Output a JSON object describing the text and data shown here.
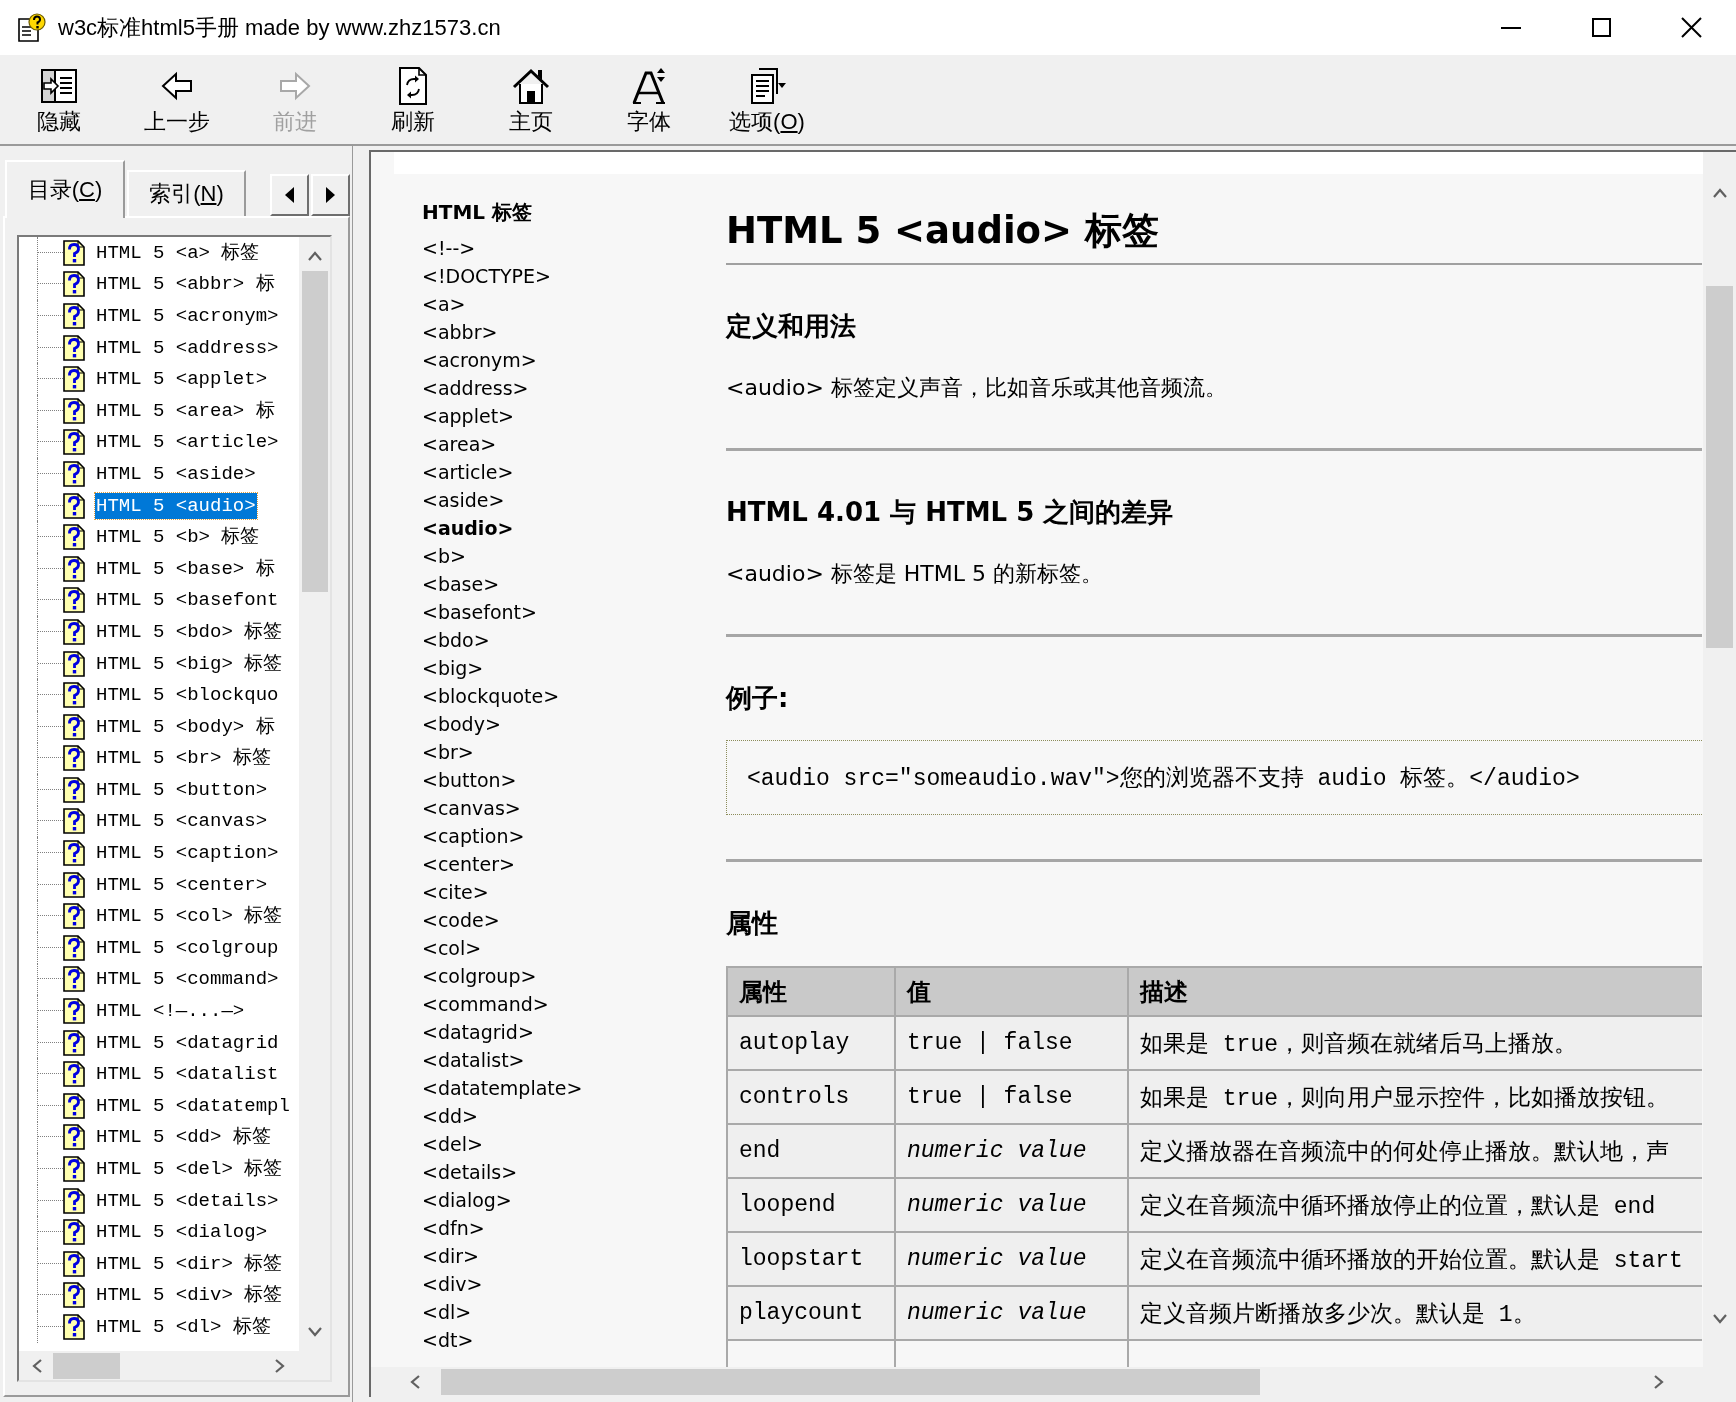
{
  "window": {
    "title": "w3c标准html5手册 made by www.zhz1573.cn"
  },
  "toolbar": [
    {
      "kind": "hide",
      "label": "隐藏",
      "disabled": false
    },
    {
      "kind": "back",
      "label": "上一步",
      "disabled": false
    },
    {
      "kind": "forward",
      "label": "前进",
      "disabled": true
    },
    {
      "kind": "refresh",
      "label": "刷新",
      "disabled": false
    },
    {
      "kind": "home",
      "label": "主页",
      "disabled": false
    },
    {
      "kind": "font",
      "label": "字体",
      "disabled": false
    },
    {
      "kind": "options",
      "label": "选项(O)",
      "disabled": false
    }
  ],
  "navigation_pane": {
    "tabs": [
      {
        "label": "目录(C)",
        "selected": true
      },
      {
        "label": "索引(N)",
        "selected": false
      }
    ],
    "tree": [
      {
        "label": "HTML 5 <a> 标签",
        "selected": false
      },
      {
        "label": "HTML 5 <abbr> 标",
        "selected": false
      },
      {
        "label": "HTML 5 <acronym>",
        "selected": false
      },
      {
        "label": "HTML 5 <address>",
        "selected": false
      },
      {
        "label": "HTML 5 <applet>",
        "selected": false
      },
      {
        "label": "HTML 5 <area> 标",
        "selected": false
      },
      {
        "label": "HTML 5 <article>",
        "selected": false
      },
      {
        "label": "HTML 5 <aside>",
        "selected": false
      },
      {
        "label": "HTML 5 <audio>",
        "selected": true
      },
      {
        "label": "HTML 5 <b> 标签",
        "selected": false
      },
      {
        "label": "HTML 5 <base> 标",
        "selected": false
      },
      {
        "label": "HTML 5 <basefont",
        "selected": false
      },
      {
        "label": "HTML 5 <bdo> 标签",
        "selected": false
      },
      {
        "label": "HTML 5 <big> 标签",
        "selected": false
      },
      {
        "label": "HTML 5 <blockquo",
        "selected": false
      },
      {
        "label": "HTML 5 <body> 标",
        "selected": false
      },
      {
        "label": "HTML 5 <br> 标签",
        "selected": false
      },
      {
        "label": "HTML 5 <button>",
        "selected": false
      },
      {
        "label": "HTML 5 <canvas>",
        "selected": false
      },
      {
        "label": "HTML 5 <caption>",
        "selected": false
      },
      {
        "label": "HTML 5 <center>",
        "selected": false
      },
      {
        "label": "HTML 5 <col> 标签",
        "selected": false
      },
      {
        "label": "HTML 5 <colgroup",
        "selected": false
      },
      {
        "label": "HTML 5 <command>",
        "selected": false
      },
      {
        "label": "HTML <!—...—>",
        "selected": false
      },
      {
        "label": "HTML 5 <datagrid",
        "selected": false
      },
      {
        "label": "HTML 5 <datalist",
        "selected": false
      },
      {
        "label": "HTML 5 <datatempl",
        "selected": false
      },
      {
        "label": "HTML 5 <dd> 标签",
        "selected": false
      },
      {
        "label": "HTML 5 <del> 标签",
        "selected": false
      },
      {
        "label": "HTML 5 <details>",
        "selected": false
      },
      {
        "label": "HTML 5 <dialog>",
        "selected": false
      },
      {
        "label": "HTML 5 <dir> 标签",
        "selected": false
      },
      {
        "label": "HTML 5 <div> 标签",
        "selected": false
      },
      {
        "label": "HTML 5 <dl> 标签",
        "selected": false
      }
    ]
  },
  "document": {
    "tag_index": {
      "heading": "HTML 标签",
      "items": [
        {
          "label": "<!-->",
          "selected": false
        },
        {
          "label": "<!DOCTYPE>",
          "selected": false
        },
        {
          "label": "<a>",
          "selected": false
        },
        {
          "label": "<abbr>",
          "selected": false
        },
        {
          "label": "<acronym>",
          "selected": false
        },
        {
          "label": "<address>",
          "selected": false
        },
        {
          "label": "<applet>",
          "selected": false
        },
        {
          "label": "<area>",
          "selected": false
        },
        {
          "label": "<article>",
          "selected": false
        },
        {
          "label": "<aside>",
          "selected": false
        },
        {
          "label": "<audio>",
          "selected": true
        },
        {
          "label": "<b>",
          "selected": false
        },
        {
          "label": "<base>",
          "selected": false
        },
        {
          "label": "<basefont>",
          "selected": false
        },
        {
          "label": "<bdo>",
          "selected": false
        },
        {
          "label": "<big>",
          "selected": false
        },
        {
          "label": "<blockquote>",
          "selected": false
        },
        {
          "label": "<body>",
          "selected": false
        },
        {
          "label": "<br>",
          "selected": false
        },
        {
          "label": "<button>",
          "selected": false
        },
        {
          "label": "<canvas>",
          "selected": false
        },
        {
          "label": "<caption>",
          "selected": false
        },
        {
          "label": "<center>",
          "selected": false
        },
        {
          "label": "<cite>",
          "selected": false
        },
        {
          "label": "<code>",
          "selected": false
        },
        {
          "label": "<col>",
          "selected": false
        },
        {
          "label": "<colgroup>",
          "selected": false
        },
        {
          "label": "<command>",
          "selected": false
        },
        {
          "label": "<datagrid>",
          "selected": false
        },
        {
          "label": "<datalist>",
          "selected": false
        },
        {
          "label": "<datatemplate>",
          "selected": false
        },
        {
          "label": "<dd>",
          "selected": false
        },
        {
          "label": "<del>",
          "selected": false
        },
        {
          "label": "<details>",
          "selected": false
        },
        {
          "label": "<dialog>",
          "selected": false
        },
        {
          "label": "<dfn>",
          "selected": false
        },
        {
          "label": "<dir>",
          "selected": false
        },
        {
          "label": "<div>",
          "selected": false
        },
        {
          "label": "<dl>",
          "selected": false
        },
        {
          "label": "<dt>",
          "selected": false
        }
      ]
    },
    "title": "HTML 5 <audio> 标签",
    "sections": [
      {
        "kind": "text",
        "heading": "定义和用法",
        "text": "<audio> 标签定义声音，比如音乐或其他音频流。"
      },
      {
        "kind": "text",
        "heading": "HTML 4.01 与 HTML 5 之间的差异",
        "text": "<audio> 标签是 HTML 5 的新标签。"
      },
      {
        "kind": "code",
        "heading": "例子:",
        "code": "<audio src=\"someaudio.wav\">您的浏览器不支持 audio 标签。</audio>"
      },
      {
        "kind": "table",
        "heading": "属性",
        "columns": [
          "属性",
          "值",
          "描述"
        ],
        "rows": [
          {
            "kind": "literal",
            "attribute": "autoplay",
            "value": "true | false",
            "description": "如果是 true，则音频在就绪后马上播放。"
          },
          {
            "kind": "literal",
            "attribute": "controls",
            "value": "true | false",
            "description": "如果是 true，则向用户显示控件，比如播放按钮。"
          },
          {
            "kind": "variable",
            "attribute": "end",
            "value": "numeric value",
            "description": "定义播放器在音频流中的何处停止播放。默认地，声"
          },
          {
            "kind": "variable",
            "attribute": "loopend",
            "value": "numeric value",
            "description": "定义在音频流中循环播放停止的位置，默认是 end"
          },
          {
            "kind": "variable",
            "attribute": "loopstart",
            "value": "numeric value",
            "description": "定义在音频流中循环播放的开始位置。默认是 start"
          },
          {
            "kind": "variable",
            "attribute": "playcount",
            "value": "numeric value",
            "description": "定义音频片断播放多少次。默认是 1。"
          }
        ]
      }
    ]
  }
}
